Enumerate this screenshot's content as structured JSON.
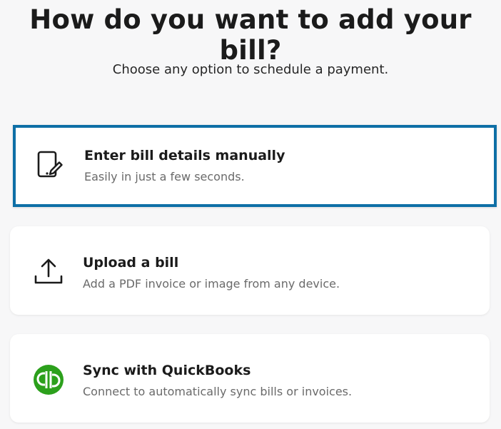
{
  "header": {
    "title": "How do you want to add your bill?",
    "subtitle": "Choose any option to schedule a payment."
  },
  "options": [
    {
      "label": "Enter bill details manually",
      "description": "Easily in just a few seconds.",
      "icon": "edit-document-icon",
      "selected": true
    },
    {
      "label": "Upload a bill",
      "description": "Add a PDF invoice or image from any device.",
      "icon": "upload-icon",
      "selected": false
    },
    {
      "label": "Sync with QuickBooks",
      "description": "Connect to automatically sync bills or invoices.",
      "icon": "quickbooks-logo-icon",
      "logo_text": "qb",
      "selected": false
    }
  ],
  "colors": {
    "selected_border": "#0e6fa6",
    "quickbooks_green": "#2ca01c",
    "background": "#f7f7f8"
  }
}
